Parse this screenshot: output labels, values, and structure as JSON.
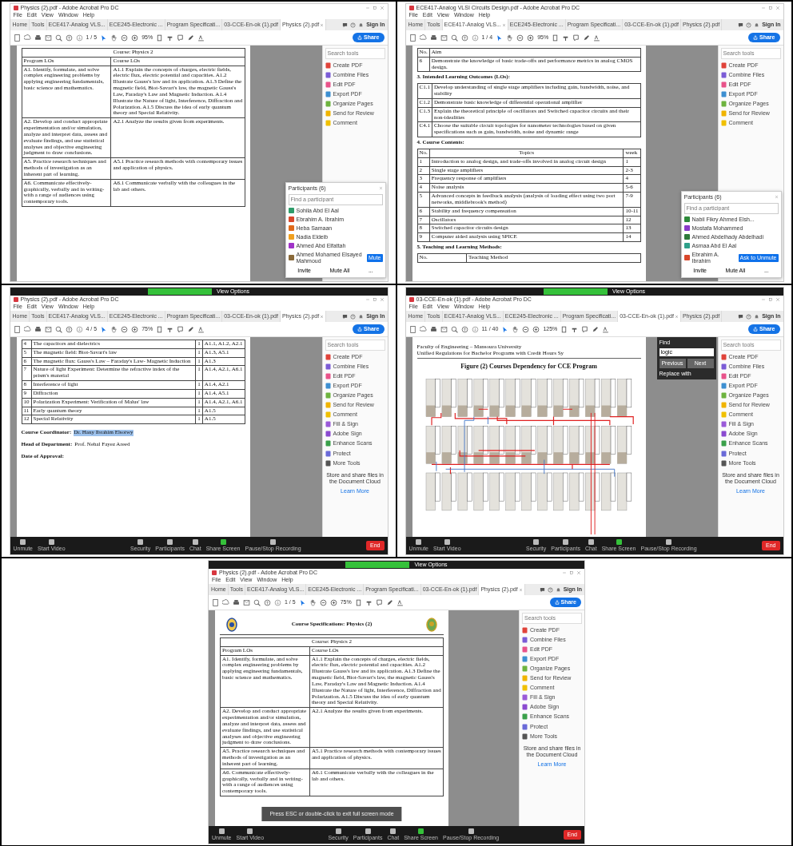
{
  "panels": [
    {
      "window_title": "Physics (2).pdf - Adobe Acrobat Pro DC",
      "menu": [
        "File",
        "Edit",
        "View",
        "Window",
        "Help"
      ],
      "tabs": [
        {
          "label": "Home",
          "selected": false
        },
        {
          "label": "Tools",
          "selected": false
        },
        {
          "label": "ECE417-Analog VLS...",
          "selected": false
        },
        {
          "label": "ECE245-Electronic ...",
          "selected": false
        },
        {
          "label": "Program Specificati...",
          "selected": false
        },
        {
          "label": "03-CCE-En-ok (1).pdf",
          "selected": false
        },
        {
          "label": "Physics (2).pdf",
          "selected": true
        }
      ],
      "sign_in": "Sign In",
      "page": "1 / 5",
      "zoom": "95%",
      "share": "Share",
      "search_placeholder": "Search tools",
      "tools": [
        {
          "label": "Create PDF",
          "color": "#e0433a"
        },
        {
          "label": "Combine Files",
          "color": "#7b5cd6"
        },
        {
          "label": "Edit PDF",
          "color": "#e8538a"
        },
        {
          "label": "Export PDF",
          "color": "#3d8fd1"
        },
        {
          "label": "Organize Pages",
          "color": "#6db33f"
        },
        {
          "label": "Send for Review",
          "color": "#f0b400"
        },
        {
          "label": "Comment",
          "color": "#f0c000"
        }
      ],
      "document": [
        {
          "kind": "table",
          "title": "Course: Physics 2",
          "columns": [
            "Program LOs",
            "Course LOs"
          ],
          "rows": [
            [
              "A1. Identify, formulate, and solve complex engineering problems by applying engineering fundamentals, basic science and mathematics.",
              "A1.1 Explain the concepts of charges, electric fields, electric flux, electric potential and capacities. A1.2 Illustrate Gauss's law and its application. A1.3 Define the magnetic field, Biot-Savart's law, the magnetic Gauss's Law, Faraday's Law and Magnetic Induction. A1.4 Illustrate the Nature of light, Interference, Diffraction and Polarization. A1.5 Discuss the idea of early quantum theory and Special Relativity."
            ],
            [
              "A2. Develop and conduct appropriate experimentation and/or simulation, analyze and interpret data, assess and evaluate findings, and use statistical analyses and objective engineering judgment to draw conclusions.",
              "A2.1 Analyze the results given from experiments."
            ],
            [
              "A5. Practice research techniques and methods of investigation as an inherent part of learning.",
              "A5.1 Practice research methods with contemporary issues and application of physics."
            ],
            [
              "A6. Communicate effectively-graphically, verbally and in writing-with a range of audiences using contemporary tools.",
              "A6.1 Communicate verbally with the colleagues in the lab and others."
            ]
          ]
        }
      ],
      "participants": {
        "title": "Participants (6)",
        "placeholder": "Find a participant",
        "people": [
          {
            "name": "Sohila Abd El Aal",
            "color": "#2e9c6a"
          },
          {
            "name": "Ebrahim A. Ibrahim",
            "color": "#d9472b"
          },
          {
            "name": "Heba Samaan",
            "color": "#e06a1b"
          },
          {
            "name": "Nadia Eldeib",
            "color": "#f0a020"
          },
          {
            "name": "Ahmed Abd Elfattah",
            "color": "#a033c8"
          },
          {
            "name": "Ahmed Mohamed Elsayed Mahmoud",
            "color": "#8a6a3a",
            "action": "Mute"
          }
        ],
        "buttons": [
          "Invite",
          "Mute All",
          "..."
        ]
      }
    },
    {
      "window_title": "ECE417-Analog VLSI Circuits Design.pdf - Adobe Acrobat Pro DC",
      "menu": [
        "File",
        "Edit",
        "View",
        "Window",
        "Help"
      ],
      "tabs": [
        {
          "label": "Home",
          "selected": false
        },
        {
          "label": "Tools",
          "selected": false
        },
        {
          "label": "ECE417-Analog VLS...",
          "selected": true
        },
        {
          "label": "ECE245-Electronic ...",
          "selected": false
        },
        {
          "label": "Program Specificati...",
          "selected": false
        },
        {
          "label": "03-CCE-En-ok (1).pdf",
          "selected": false
        },
        {
          "label": "Physics (2).pdf",
          "selected": false
        }
      ],
      "sign_in": "Sign In",
      "page": "1 / 4",
      "zoom": "95%",
      "share": "Share",
      "search_placeholder": "Search tools",
      "tools": [
        {
          "label": "Create PDF",
          "color": "#e0433a"
        },
        {
          "label": "Combine Files",
          "color": "#7b5cd6"
        },
        {
          "label": "Edit PDF",
          "color": "#e8538a"
        },
        {
          "label": "Export PDF",
          "color": "#3d8fd1"
        },
        {
          "label": "Organize Pages",
          "color": "#6db33f"
        },
        {
          "label": "Send for Review",
          "color": "#f0b400"
        },
        {
          "label": "Comment",
          "color": "#f0c000"
        }
      ],
      "document": [
        {
          "kind": "table",
          "columns": [
            "No.",
            "Aim"
          ],
          "rows": [
            [
              "6",
              "Demonstrate the knowledge of basic trade-offs and performance metrics in analog CMOS design."
            ]
          ]
        },
        {
          "kind": "heading",
          "text": "3. Intended Learning Outcomes (LOs):"
        },
        {
          "kind": "table",
          "rows": [
            [
              "C1.1",
              "Develop understanding of single stage amplifiers including gain, bandwidth, noise, and stability"
            ],
            [
              "C1.2",
              "Demonstrate basic knowledge of differential operational amplifier"
            ],
            [
              "C1.3",
              "Explain the theoretical principle of oscillators and Switched capacitor circuits and their non-idealities"
            ],
            [
              "C4.1",
              "Choose the suitable circuit topologies for nanometer technologies based on given specifications such as gain, bandwidth, noise and dynamic range"
            ]
          ]
        },
        {
          "kind": "heading",
          "text": "4. Course Contents:"
        },
        {
          "kind": "table",
          "columns": [
            "No.",
            "Topics",
            "week"
          ],
          "rows": [
            [
              "1",
              "Introduction to analog design, and trade-offs involved in analog circuit design",
              "1"
            ],
            [
              "2",
              "Single stage amplifiers",
              "2-3"
            ],
            [
              "3",
              "Frequency response of amplifiers",
              "4"
            ],
            [
              "4",
              "Noise analysis",
              "5-6"
            ],
            [
              "5",
              "Advanced concepts in feedback analysis (analysis of loading effect using two port networks, middlebrook's method)",
              "7-9"
            ],
            [
              "6",
              "Stability and frequency compensation",
              "10-11"
            ],
            [
              "7",
              "Oscillators",
              "12"
            ],
            [
              "8",
              "Switched capacitor circuits design",
              "13"
            ],
            [
              "9",
              "Computer aided analysis using SPICE",
              "14"
            ]
          ]
        },
        {
          "kind": "heading",
          "text": "5. Teaching and Learning Methods:"
        },
        {
          "kind": "table",
          "columns": [
            "No.",
            "Teaching Method"
          ]
        }
      ],
      "participants": {
        "title": "Participants (6)",
        "placeholder": "Find a participant",
        "people": [
          {
            "name": "Nabil Fikry Ahmed Elsh...",
            "color": "#2e8a3a"
          },
          {
            "name": "Mostafa Mohammed",
            "color": "#8a3ac8"
          },
          {
            "name": "Ahmed Abdelhady Abdelhadi",
            "color": "#2e7a3a"
          },
          {
            "name": "Asmaa Abd El Aal",
            "color": "#2ea08a"
          },
          {
            "name": "Ebrahim A. Ibrahim",
            "color": "#d9472b",
            "action": "Ask to Unmute"
          }
        ],
        "buttons": [
          "Invite",
          "Mute All",
          "..."
        ]
      }
    },
    {
      "window_title": "Physics (2).pdf - Adobe Acrobat Pro DC",
      "menu": [
        "File",
        "Edit",
        "View",
        "Window",
        "Help"
      ],
      "tabs": [
        {
          "label": "Home",
          "selected": false
        },
        {
          "label": "Tools",
          "selected": false
        },
        {
          "label": "ECE417-Analog VLS...",
          "selected": false
        },
        {
          "label": "ECE245-Electronic ...",
          "selected": false
        },
        {
          "label": "Program Specificati...",
          "selected": false
        },
        {
          "label": "03-CCE-En-ok (1).pdf",
          "selected": false
        },
        {
          "label": "Physics (2).pdf",
          "selected": true
        }
      ],
      "sign_in": "Sign In",
      "page": "4 / 5",
      "zoom": "75%",
      "share": "Share",
      "search_placeholder": "Search tools",
      "tools": [
        {
          "label": "Create PDF",
          "color": "#e0433a"
        },
        {
          "label": "Combine Files",
          "color": "#7b5cd6"
        },
        {
          "label": "Edit PDF",
          "color": "#e8538a"
        },
        {
          "label": "Export PDF",
          "color": "#3d8fd1"
        },
        {
          "label": "Organize Pages",
          "color": "#6db33f"
        },
        {
          "label": "Send for Review",
          "color": "#f0b400"
        },
        {
          "label": "Comment",
          "color": "#f0c000"
        },
        {
          "label": "Fill & Sign",
          "color": "#9a5ad8"
        },
        {
          "label": "Adobe Sign",
          "color": "#8a4ad0"
        },
        {
          "label": "Enhance Scans",
          "color": "#3aa04a"
        },
        {
          "label": "Protect",
          "color": "#6a6ad8"
        },
        {
          "label": "More Tools",
          "color": "#555555"
        }
      ],
      "cloud_note": "Store and share files in the Document Cloud",
      "learn_more": "Learn More",
      "document": [
        {
          "kind": "table",
          "rows": [
            [
              "4",
              "The capacitors and dielectrics",
              "1",
              "A1.1, A1.2, A2.1"
            ],
            [
              "5",
              "The magnetic field: Biot-Savart's law",
              "1",
              "A1.3, A5.1"
            ],
            [
              "6",
              "The magnetic flux: Gauss's Law – Faraday's Law- Magnetic Induction",
              "1",
              "A1.3"
            ],
            [
              "7",
              "Nature of light Experiment: Determine the refractive index of the prism's material",
              "1",
              "A1.4, A2.1, A6.1"
            ],
            [
              "8",
              "Interference of light",
              "1",
              "A1.4, A2.1"
            ],
            [
              "9",
              "Diffraction",
              "1",
              "A1.4, A5.1"
            ],
            [
              "10",
              "Polarization Experiment: Verification of Malus' law",
              "1",
              "A1.4, A2.1, A6.1"
            ],
            [
              "11",
              "Early quantum theory",
              "1",
              "A1.5"
            ],
            [
              "12",
              "Special Relativity",
              "1",
              "A1.5"
            ]
          ]
        },
        {
          "kind": "field",
          "label": "Course Coordinator:",
          "value": "Dr. Hany Ibrahim Elsotwy",
          "highlighted": true
        },
        {
          "kind": "field",
          "label": "Head of Department:",
          "value": "Prof. Nehal Fayez Areed",
          "highlighted": false
        },
        {
          "kind": "field",
          "label": "Date of Approval:"
        }
      ],
      "zoom_bar": {
        "view_options": "View Options",
        "controls": [
          "Unmute",
          "Start Video",
          "Security",
          "Participants",
          "Chat",
          "Share Screen",
          "Pause/Stop Recording"
        ],
        "end": "End"
      }
    },
    {
      "window_title": "03-CCE-En-ok (1).pdf - Adobe Acrobat Pro DC",
      "menu": [
        "File",
        "Edit",
        "View",
        "Window",
        "Help"
      ],
      "tabs": [
        {
          "label": "Home",
          "selected": false
        },
        {
          "label": "Tools",
          "selected": false
        },
        {
          "label": "ECE417-Analog VLS...",
          "selected": false
        },
        {
          "label": "ECE245-Electronic ...",
          "selected": false
        },
        {
          "label": "Program Specificati...",
          "selected": false
        },
        {
          "label": "03-CCE-En-ok (1).pdf",
          "selected": true
        },
        {
          "label": "Physics (2).pdf",
          "selected": false
        }
      ],
      "sign_in": "Sign In",
      "page": "11 / 40",
      "zoom": "125%",
      "share": "Share",
      "search_placeholder": "Search tools",
      "tools": [
        {
          "label": "Create PDF",
          "color": "#e0433a"
        },
        {
          "label": "Combine Files",
          "color": "#7b5cd6"
        },
        {
          "label": "Edit PDF",
          "color": "#e8538a"
        },
        {
          "label": "Export PDF",
          "color": "#3d8fd1"
        },
        {
          "label": "Organize Pages",
          "color": "#6db33f"
        },
        {
          "label": "Send for Review",
          "color": "#f0b400"
        },
        {
          "label": "Comment",
          "color": "#f0c000"
        },
        {
          "label": "Fill & Sign",
          "color": "#9a5ad8"
        },
        {
          "label": "Adobe Sign",
          "color": "#8a4ad0"
        },
        {
          "label": "Enhance Scans",
          "color": "#3aa04a"
        },
        {
          "label": "Protect",
          "color": "#6a6ad8"
        },
        {
          "label": "More Tools",
          "color": "#555555"
        }
      ],
      "cloud_note": "Store and share files in the Document Cloud",
      "learn_more": "Learn More",
      "document": [
        {
          "kind": "running-header",
          "left": "Faculty of Engineering – Mansoura University",
          "right": "Unified Regulations for Bachelor Programs with Credit Hours Sy"
        },
        {
          "kind": "figure-title",
          "text": "Figure (2) Courses Dependency for CCE Program"
        },
        {
          "kind": "diagram"
        }
      ],
      "find": {
        "title": "Find",
        "value": "logic",
        "buttons": [
          "Previous",
          "Next"
        ],
        "replace": "Replace with"
      },
      "zoom_bar": {
        "view_options": "View Options",
        "controls": [
          "Unmute",
          "Start Video",
          "Security",
          "Participants",
          "Chat",
          "Share Screen",
          "Pause/Stop Recording"
        ],
        "end": "End"
      }
    },
    {
      "window_title": "Physics (2).pdf - Adobe Acrobat Pro DC",
      "menu": [
        "File",
        "Edit",
        "View",
        "Window",
        "Help"
      ],
      "tabs": [
        {
          "label": "Home",
          "selected": false
        },
        {
          "label": "Tools",
          "selected": false
        },
        {
          "label": "ECE417-Analog VLS...",
          "selected": false
        },
        {
          "label": "ECE245-Electronic ...",
          "selected": false
        },
        {
          "label": "Program Specificati...",
          "selected": false
        },
        {
          "label": "03-CCE-En-ok (1).pdf",
          "selected": false
        },
        {
          "label": "Physics (2).pdf",
          "selected": true
        }
      ],
      "sign_in": "Sign In",
      "page": "1 / 5",
      "zoom": "75%",
      "share": "Share",
      "search_placeholder": "Search tools",
      "tools": [
        {
          "label": "Create PDF",
          "color": "#e0433a"
        },
        {
          "label": "Combine Files",
          "color": "#7b5cd6"
        },
        {
          "label": "Edit PDF",
          "color": "#e8538a"
        },
        {
          "label": "Export PDF",
          "color": "#3d8fd1"
        },
        {
          "label": "Organize Pages",
          "color": "#6db33f"
        },
        {
          "label": "Send for Review",
          "color": "#f0b400"
        },
        {
          "label": "Comment",
          "color": "#f0c000"
        },
        {
          "label": "Fill & Sign",
          "color": "#9a5ad8"
        },
        {
          "label": "Adobe Sign",
          "color": "#8a4ad0"
        },
        {
          "label": "Enhance Scans",
          "color": "#3aa04a"
        },
        {
          "label": "Protect",
          "color": "#6a6ad8"
        },
        {
          "label": "More Tools",
          "color": "#555555"
        }
      ],
      "cloud_note": "Store and share files in the Document Cloud",
      "learn_more": "Learn More",
      "document": [
        {
          "kind": "logo-header",
          "text": "Course Specifications: Physics (2)"
        },
        {
          "kind": "table",
          "title": "Course: Physics 2",
          "columns": [
            "Program LOs",
            "Course LOs"
          ],
          "rows": [
            [
              "A1. Identify, formulate, and solve complex engineering problems by applying engineering fundamentals, basic science and mathematics.",
              "A1.1 Explain the concepts of charges, electric fields, electric flux, electric potential and capacities. A1.2 Illustrate Gauss's law and its application. A1.3 Define the magnetic field, Biot-Savart's law, the magnetic Gauss's Law, Faraday's Law and Magnetic Induction. A1.4 Illustrate the Nature of light, Interference, Diffraction and Polarization. A1.5 Discuss the idea of early quantum theory and Special Relativity."
            ],
            [
              "A2. Develop and conduct appropriate experimentation and/or simulation, analyze and interpret data, assess and evaluate findings, and use statistical analyses and objective engineering judgment to draw conclusions.",
              "A2.1 Analyze the results given from experiments."
            ],
            [
              "A5. Practice research techniques and methods of investigation as an inherent part of learning.",
              "A5.1 Practice research methods with contemporary issues and application of physics."
            ],
            [
              "A6. Communicate effectively-graphically, verbally and in writing-with a range of audiences using contemporary tools.",
              "A6.1 Communicate verbally with the colleagues in the lab and others."
            ]
          ]
        }
      ],
      "toast": "Press ESC or double-click to exit full screen mode",
      "zoom_bar": {
        "view_options": "View Options",
        "controls": [
          "Unmute",
          "Start Video",
          "Security",
          "Participants",
          "Chat",
          "Share Screen",
          "Pause/Stop Recording"
        ],
        "end": "End"
      }
    }
  ]
}
